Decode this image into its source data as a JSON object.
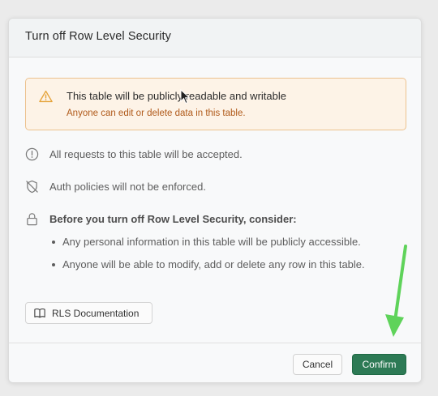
{
  "dialog": {
    "title": "Turn off Row Level Security"
  },
  "alert": {
    "icon": "warning-triangle-icon",
    "title": "This table will be publicly readable and writable",
    "description": "Anyone can edit or delete data in this table."
  },
  "info_rows": [
    {
      "icon": "alert-circle-icon",
      "text": "All requests to this table will be accepted."
    },
    {
      "icon": "shield-off-icon",
      "text": "Auth policies will not be enforced."
    }
  ],
  "consider": {
    "icon": "lock-icon",
    "title": "Before you turn off Row Level Security, consider:",
    "items": [
      "Any personal information in this table will be publicly accessible.",
      "Anyone will be able to modify, add or delete any row in this table."
    ]
  },
  "doc_button": {
    "icon": "book-open-icon",
    "label": "RLS Documentation"
  },
  "footer": {
    "cancel_label": "Cancel",
    "confirm_label": "Confirm"
  },
  "colors": {
    "confirm_bg": "#2d7a55",
    "alert_bg": "#fdf3e7",
    "alert_border": "#ecc28e",
    "alert_desc": "#b05a1a",
    "annotation_arrow": "#5fd35a"
  }
}
